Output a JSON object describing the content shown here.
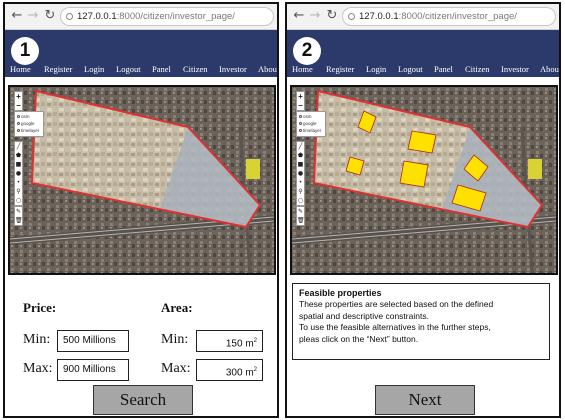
{
  "browser": {
    "url_host": "127.0.0.1",
    "url_path": ":8000/citizen/investor_page/"
  },
  "nav": {
    "items": [
      "Home",
      "Register",
      "Login",
      "Logout",
      "Panel",
      "Citizen",
      "Investor",
      "About"
    ]
  },
  "map": {
    "layers": [
      "osm",
      "google",
      "timelayer"
    ],
    "zoom_in": "+",
    "zoom_out": "−"
  },
  "panel1": {
    "step": "1",
    "price_label": "Price:",
    "area_label": "Area:",
    "min_label": "Min:",
    "max_label": "Max:",
    "price_min": "500 Millions",
    "price_max": "900 Millions",
    "area_min_value": "150 m",
    "area_max_value": "300 m",
    "area_unit_sup": "2",
    "search_label": "Search"
  },
  "panel2": {
    "step": "2",
    "info_title": "Feasible properties",
    "info_lines": [
      "These properties are selected based on the defined",
      "spatial and descriptive constraints.",
      "To use the feasible alternatives in the further steps,",
      "pleas click on the “Next” button."
    ],
    "next_label": "Next"
  },
  "colors": {
    "header": "#2b3a6b",
    "boundary": "#e03030",
    "selected_parcel": "#ffe100",
    "button": "#a6a6a6"
  }
}
